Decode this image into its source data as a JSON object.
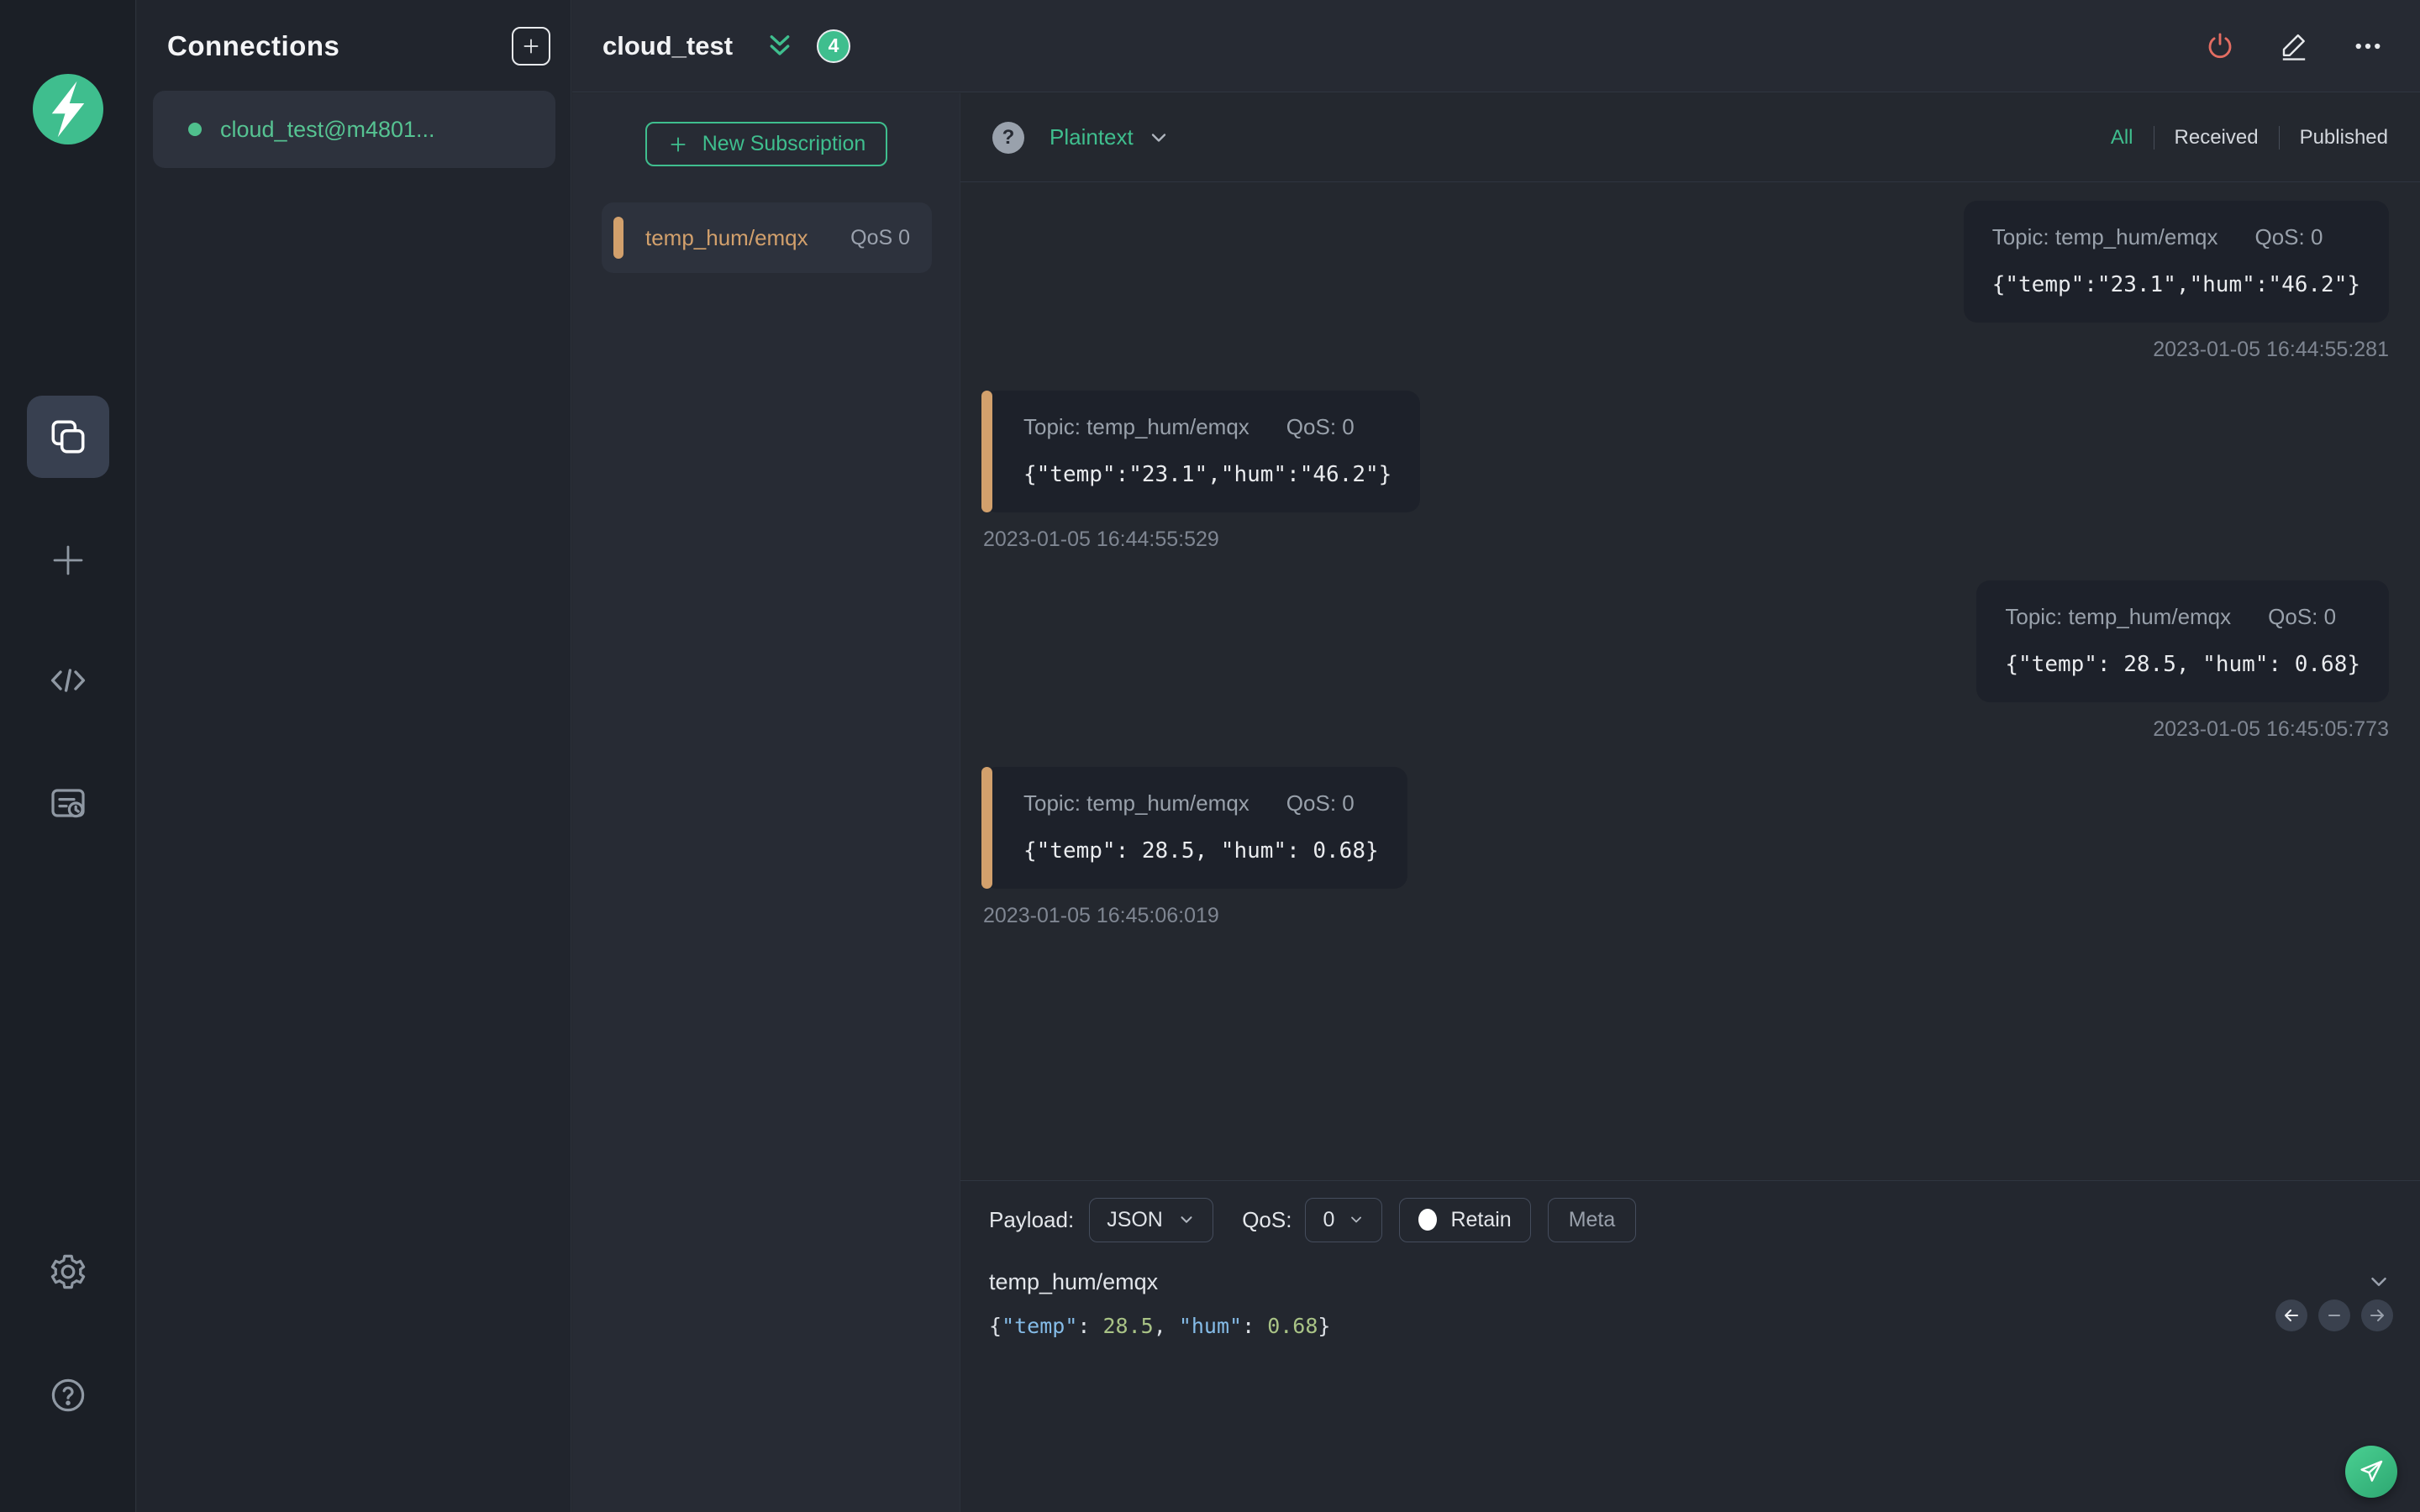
{
  "colors": {
    "accent_green": "#3fbe8e",
    "accent_orange": "#d2a06c",
    "power_red": "#e36d62",
    "bubble_bg": "#1d212a"
  },
  "sidebar": {
    "icons": [
      {
        "name": "connections",
        "active": true
      },
      {
        "name": "new-connection",
        "active": false
      },
      {
        "name": "script",
        "active": false
      },
      {
        "name": "log",
        "active": false
      }
    ],
    "footer_icons": [
      {
        "name": "settings"
      },
      {
        "name": "help"
      }
    ]
  },
  "connections_panel": {
    "title": "Connections",
    "items": [
      {
        "name": "cloud_test@m4801...",
        "status": "connected"
      }
    ]
  },
  "header": {
    "title": "cloud_test",
    "unread_badge": "4",
    "icons": [
      {
        "name": "disconnect-power"
      },
      {
        "name": "edit-pencil"
      },
      {
        "name": "more-ellipsis"
      }
    ]
  },
  "subscriptions": {
    "new_button_label": "New Subscription",
    "items": [
      {
        "topic": "temp_hum/emqx",
        "qos": "QoS 0"
      }
    ]
  },
  "messages": {
    "format": "Plaintext",
    "help_glyph": "?",
    "filters": {
      "all": "All",
      "received": "Received",
      "published": "Published",
      "active": "All"
    },
    "items": [
      {
        "direction": "published",
        "topic": "Topic: temp_hum/emqx",
        "qos": "QoS: 0",
        "payload": "{\"temp\":\"23.1\",\"hum\":\"46.2\"}",
        "timestamp": "2023-01-05 16:44:55:281"
      },
      {
        "direction": "received",
        "topic": "Topic: temp_hum/emqx",
        "qos": "QoS: 0",
        "payload": "{\"temp\":\"23.1\",\"hum\":\"46.2\"}",
        "timestamp": "2023-01-05 16:44:55:529"
      },
      {
        "direction": "published",
        "topic": "Topic: temp_hum/emqx",
        "qos": "QoS: 0",
        "payload": "{\"temp\": 28.5, \"hum\": 0.68}",
        "timestamp": "2023-01-05 16:45:05:773"
      },
      {
        "direction": "received",
        "topic": "Topic: temp_hum/emqx",
        "qos": "QoS: 0",
        "payload": "{\"temp\": 28.5, \"hum\": 0.68}",
        "timestamp": "2023-01-05 16:45:06:019"
      }
    ]
  },
  "publish": {
    "payload_label": "Payload:",
    "payload_format": "JSON",
    "qos_label": "QoS:",
    "qos_value": "0",
    "retain_label": "Retain",
    "meta_label": "Meta",
    "topic": "temp_hum/emqx",
    "editor_tokens": {
      "open_brace": "{",
      "key_temp": "\"temp\"",
      "colon1": ": ",
      "num_temp": "28.5",
      "comma": ", ",
      "key_hum": "\"hum\"",
      "colon2": ": ",
      "num_hum": "0.68",
      "close_brace": "}"
    }
  }
}
